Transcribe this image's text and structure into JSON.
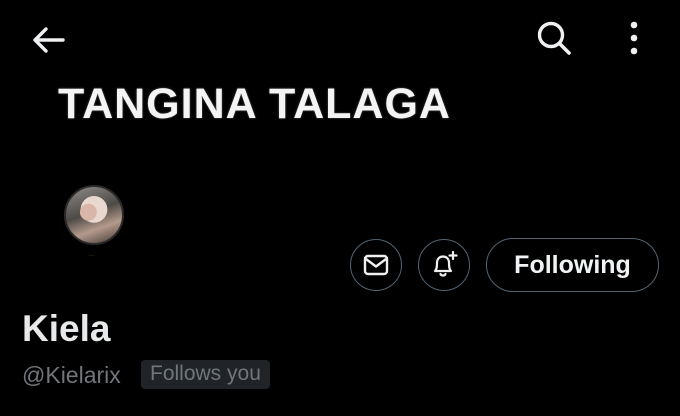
{
  "header": {
    "back_icon": "arrow-left-icon",
    "search_icon": "search-icon",
    "more_icon": "more-vertical-icon"
  },
  "banner": {
    "text": "TANGINA TALAGA"
  },
  "profile": {
    "display_name": "Kiela",
    "handle": "@Kielarix",
    "follows_you": "Follows you",
    "avatar_icon": "crescent-moon-icon"
  },
  "actions": {
    "message_icon": "envelope-icon",
    "notify_icon": "bell-plus-icon",
    "following_label": "Following"
  },
  "colors": {
    "background": "#000000",
    "text_primary": "#e7e9ea",
    "text_secondary": "#71767b",
    "border": "#536471",
    "moon": "#f5c518"
  }
}
